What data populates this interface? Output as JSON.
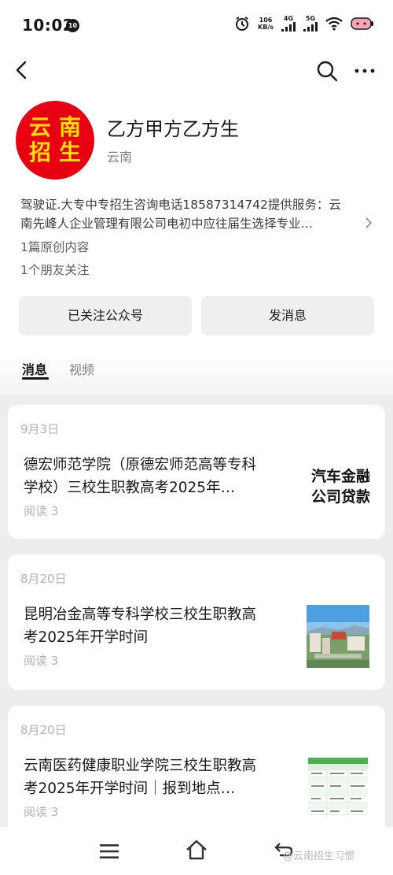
{
  "status_bar": {
    "time": "10:02",
    "notification_count": "10",
    "net_speed_value": "106",
    "net_speed_unit": "KB/s",
    "signal_1_label": "4G",
    "signal_2_label": "5G"
  },
  "nav": {
    "back_icon": "chevron-left-icon",
    "search_icon": "search-icon",
    "more_icon": "more-icon"
  },
  "profile": {
    "logo_chars": [
      "云",
      "南",
      "招",
      "生"
    ],
    "name": "乙方甲方乙方生",
    "region": "云南",
    "description_line1": "驾驶证.大专中专招生咨询电话18587314742提供服务：云",
    "description_line2": "南先峰人企业管理有限公司电初中应往届生选择专业…",
    "original_count": "1篇原创内容",
    "friends_following": "1个朋友关注"
  },
  "actions": {
    "follow_label": "已关注公众号",
    "message_label": "发消息"
  },
  "tabs": [
    {
      "label": "消息",
      "active": true
    },
    {
      "label": "视频",
      "active": false
    }
  ],
  "articles": [
    {
      "date": "9月3日",
      "title_line1": "德宏师范学院（原德宏师范高等专科",
      "title_line2": "学校）三校生职教高考2025年…",
      "reads": "阅读 3",
      "thumb_line1": "汽车金融",
      "thumb_line2": "公司贷款"
    },
    {
      "date": "8月20日",
      "title_line1": "昆明冶金高等专科学校三校生职教高",
      "title_line2": "考2025年开学时间",
      "reads": "阅读 3"
    },
    {
      "date": "8月20日",
      "title_line1": "云南医药健康职业学院三校生职教高",
      "title_line2": "考2025年开学时间｜报到地点…",
      "reads": "阅读 3"
    }
  ],
  "bottom_nav": {
    "watermark": "@云南招生习惯"
  },
  "colors": {
    "brand_red": "#e60012",
    "brand_yellow": "#ffe100",
    "background": "#ededed",
    "muted_text": "#b2b2b2"
  }
}
